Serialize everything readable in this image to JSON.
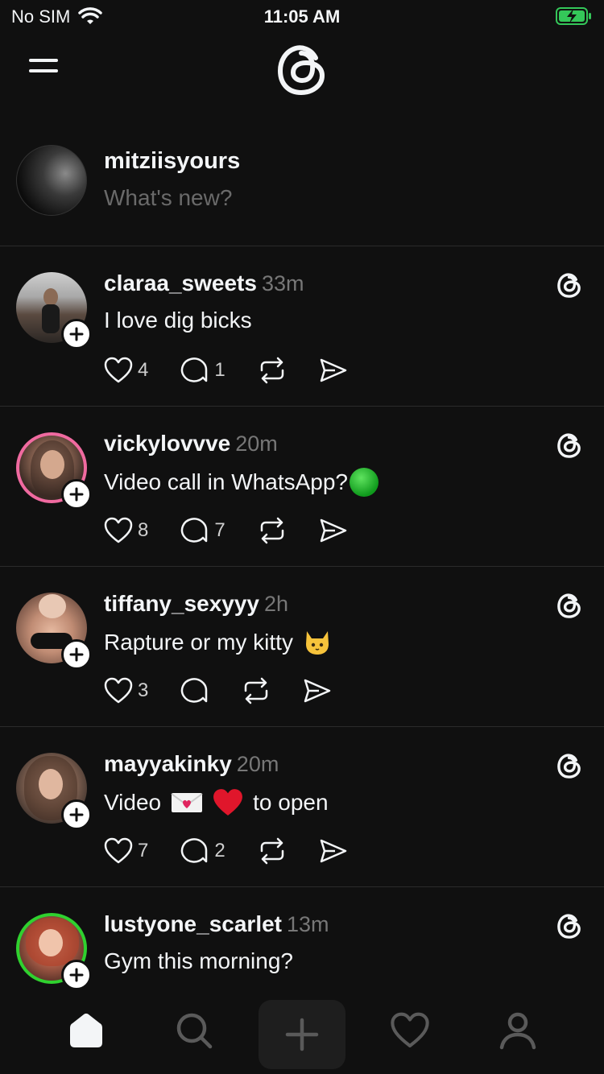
{
  "status": {
    "carrier": "No SIM",
    "time": "11:05 AM"
  },
  "composer": {
    "username": "mitziisyours",
    "placeholder": "What's new?"
  },
  "posts": [
    {
      "username": "claraa_sweets",
      "time": "33m",
      "text": "I love dig bicks",
      "likes": "4",
      "replies": "1",
      "ring": "none"
    },
    {
      "username": "vickylovvve",
      "time": "20m",
      "text": "Video call in WhatsApp?",
      "likes": "8",
      "replies": "7",
      "ring": "pink"
    },
    {
      "username": "tiffany_sexyyy",
      "time": "2h",
      "text": "Rapture or my kitty",
      "likes": "3",
      "replies": "",
      "ring": "none"
    },
    {
      "username": "mayyakinky",
      "time": "20m",
      "text_before": "Video",
      "text_after": "to open",
      "likes": "7",
      "replies": "2",
      "ring": "none"
    },
    {
      "username": "lustyone_scarlet",
      "time": "13m",
      "text": "Gym this morning?",
      "ring": "green"
    }
  ],
  "icons": {
    "status": [
      "wifi-icon",
      "battery-charging-icon"
    ],
    "nav": [
      "menu-icon",
      "threads-logo"
    ],
    "actions": [
      "heart-icon",
      "comment-icon",
      "repost-icon",
      "share-icon"
    ],
    "tabs": [
      "home-icon",
      "search-icon",
      "create-icon",
      "activity-icon",
      "profile-icon"
    ]
  },
  "colors": {
    "background": "#101010",
    "text": "#f3f5f7",
    "muted": "#777777",
    "battery": "#34c759",
    "pink_ring": "#f06aa0",
    "green_ring": "#2fd12f"
  }
}
